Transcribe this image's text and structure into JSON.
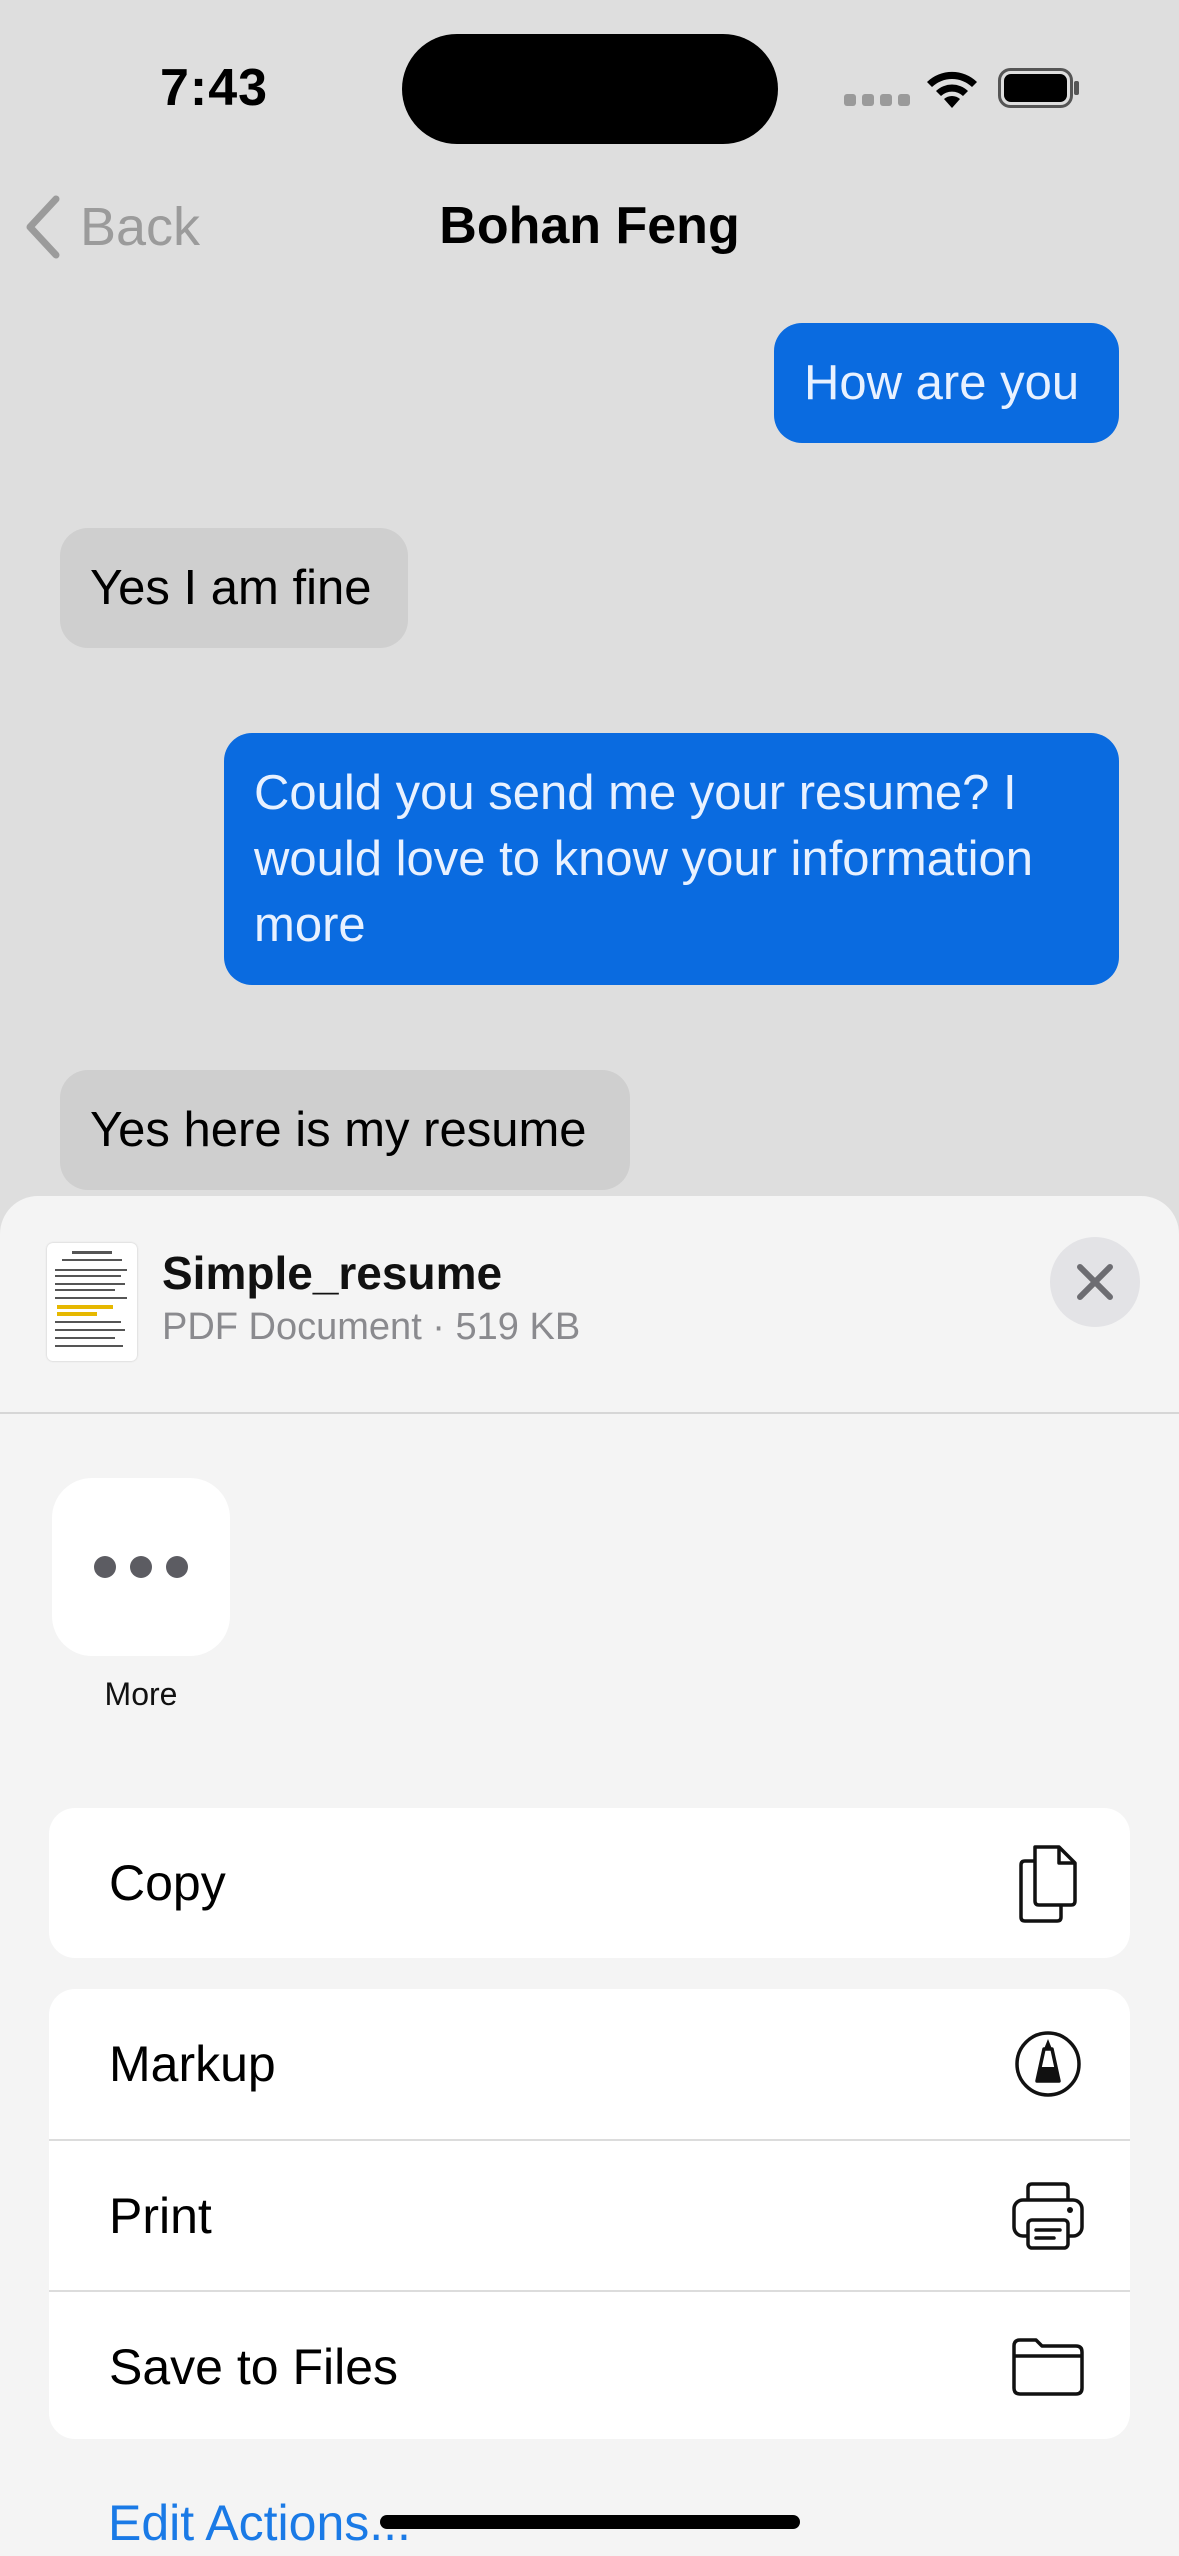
{
  "status_bar": {
    "time": "7:43",
    "icons": [
      "signal-icon",
      "wifi-icon",
      "battery-icon"
    ]
  },
  "nav": {
    "back_label": "Back",
    "title": "Bohan Feng"
  },
  "messages": [
    {
      "direction": "outgoing",
      "text": "How are you"
    },
    {
      "direction": "incoming",
      "text": "Yes I am fine"
    },
    {
      "direction": "outgoing",
      "text": "Could you send me your resume? I would love to know your information more"
    },
    {
      "direction": "incoming",
      "text": "Yes here is my resume"
    }
  ],
  "share_sheet": {
    "file_name": "Simple_resume",
    "file_meta": "PDF Document · 519 KB",
    "apps": [
      {
        "label": "More",
        "icon": "ellipsis-icon"
      }
    ],
    "action_groups": [
      [
        {
          "label": "Copy",
          "icon": "copy-icon"
        }
      ],
      [
        {
          "label": "Markup",
          "icon": "markup-icon"
        },
        {
          "label": "Print",
          "icon": "printer-icon"
        },
        {
          "label": "Save to Files",
          "icon": "folder-icon"
        }
      ]
    ],
    "edit_actions_label": "Edit Actions..."
  },
  "colors": {
    "outgoing_bubble": "#0a6be0",
    "incoming_bubble": "#cfcfcf",
    "link": "#1a7ae6"
  }
}
